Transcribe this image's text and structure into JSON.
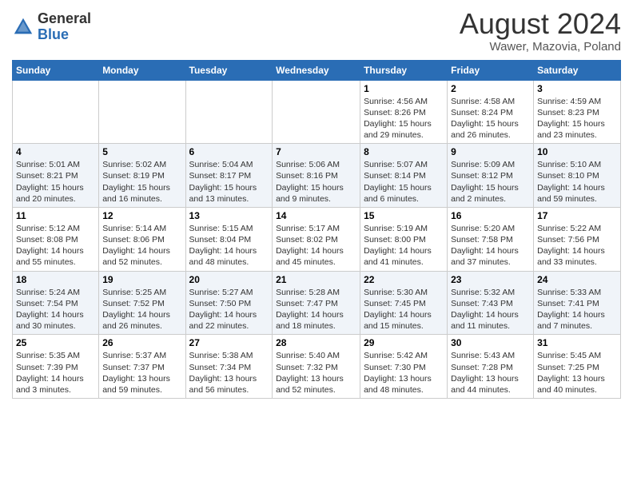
{
  "logo": {
    "general": "General",
    "blue": "Blue"
  },
  "header": {
    "month_year": "August 2024",
    "location": "Wawer, Mazovia, Poland"
  },
  "days_of_week": [
    "Sunday",
    "Monday",
    "Tuesday",
    "Wednesday",
    "Thursday",
    "Friday",
    "Saturday"
  ],
  "weeks": [
    [
      {
        "day": "",
        "info": ""
      },
      {
        "day": "",
        "info": ""
      },
      {
        "day": "",
        "info": ""
      },
      {
        "day": "",
        "info": ""
      },
      {
        "day": "1",
        "info": "Sunrise: 4:56 AM\nSunset: 8:26 PM\nDaylight: 15 hours\nand 29 minutes."
      },
      {
        "day": "2",
        "info": "Sunrise: 4:58 AM\nSunset: 8:24 PM\nDaylight: 15 hours\nand 26 minutes."
      },
      {
        "day": "3",
        "info": "Sunrise: 4:59 AM\nSunset: 8:23 PM\nDaylight: 15 hours\nand 23 minutes."
      }
    ],
    [
      {
        "day": "4",
        "info": "Sunrise: 5:01 AM\nSunset: 8:21 PM\nDaylight: 15 hours\nand 20 minutes."
      },
      {
        "day": "5",
        "info": "Sunrise: 5:02 AM\nSunset: 8:19 PM\nDaylight: 15 hours\nand 16 minutes."
      },
      {
        "day": "6",
        "info": "Sunrise: 5:04 AM\nSunset: 8:17 PM\nDaylight: 15 hours\nand 13 minutes."
      },
      {
        "day": "7",
        "info": "Sunrise: 5:06 AM\nSunset: 8:16 PM\nDaylight: 15 hours\nand 9 minutes."
      },
      {
        "day": "8",
        "info": "Sunrise: 5:07 AM\nSunset: 8:14 PM\nDaylight: 15 hours\nand 6 minutes."
      },
      {
        "day": "9",
        "info": "Sunrise: 5:09 AM\nSunset: 8:12 PM\nDaylight: 15 hours\nand 2 minutes."
      },
      {
        "day": "10",
        "info": "Sunrise: 5:10 AM\nSunset: 8:10 PM\nDaylight: 14 hours\nand 59 minutes."
      }
    ],
    [
      {
        "day": "11",
        "info": "Sunrise: 5:12 AM\nSunset: 8:08 PM\nDaylight: 14 hours\nand 55 minutes."
      },
      {
        "day": "12",
        "info": "Sunrise: 5:14 AM\nSunset: 8:06 PM\nDaylight: 14 hours\nand 52 minutes."
      },
      {
        "day": "13",
        "info": "Sunrise: 5:15 AM\nSunset: 8:04 PM\nDaylight: 14 hours\nand 48 minutes."
      },
      {
        "day": "14",
        "info": "Sunrise: 5:17 AM\nSunset: 8:02 PM\nDaylight: 14 hours\nand 45 minutes."
      },
      {
        "day": "15",
        "info": "Sunrise: 5:19 AM\nSunset: 8:00 PM\nDaylight: 14 hours\nand 41 minutes."
      },
      {
        "day": "16",
        "info": "Sunrise: 5:20 AM\nSunset: 7:58 PM\nDaylight: 14 hours\nand 37 minutes."
      },
      {
        "day": "17",
        "info": "Sunrise: 5:22 AM\nSunset: 7:56 PM\nDaylight: 14 hours\nand 33 minutes."
      }
    ],
    [
      {
        "day": "18",
        "info": "Sunrise: 5:24 AM\nSunset: 7:54 PM\nDaylight: 14 hours\nand 30 minutes."
      },
      {
        "day": "19",
        "info": "Sunrise: 5:25 AM\nSunset: 7:52 PM\nDaylight: 14 hours\nand 26 minutes."
      },
      {
        "day": "20",
        "info": "Sunrise: 5:27 AM\nSunset: 7:50 PM\nDaylight: 14 hours\nand 22 minutes."
      },
      {
        "day": "21",
        "info": "Sunrise: 5:28 AM\nSunset: 7:47 PM\nDaylight: 14 hours\nand 18 minutes."
      },
      {
        "day": "22",
        "info": "Sunrise: 5:30 AM\nSunset: 7:45 PM\nDaylight: 14 hours\nand 15 minutes."
      },
      {
        "day": "23",
        "info": "Sunrise: 5:32 AM\nSunset: 7:43 PM\nDaylight: 14 hours\nand 11 minutes."
      },
      {
        "day": "24",
        "info": "Sunrise: 5:33 AM\nSunset: 7:41 PM\nDaylight: 14 hours\nand 7 minutes."
      }
    ],
    [
      {
        "day": "25",
        "info": "Sunrise: 5:35 AM\nSunset: 7:39 PM\nDaylight: 14 hours\nand 3 minutes."
      },
      {
        "day": "26",
        "info": "Sunrise: 5:37 AM\nSunset: 7:37 PM\nDaylight: 13 hours\nand 59 minutes."
      },
      {
        "day": "27",
        "info": "Sunrise: 5:38 AM\nSunset: 7:34 PM\nDaylight: 13 hours\nand 56 minutes."
      },
      {
        "day": "28",
        "info": "Sunrise: 5:40 AM\nSunset: 7:32 PM\nDaylight: 13 hours\nand 52 minutes."
      },
      {
        "day": "29",
        "info": "Sunrise: 5:42 AM\nSunset: 7:30 PM\nDaylight: 13 hours\nand 48 minutes."
      },
      {
        "day": "30",
        "info": "Sunrise: 5:43 AM\nSunset: 7:28 PM\nDaylight: 13 hours\nand 44 minutes."
      },
      {
        "day": "31",
        "info": "Sunrise: 5:45 AM\nSunset: 7:25 PM\nDaylight: 13 hours\nand 40 minutes."
      }
    ]
  ]
}
